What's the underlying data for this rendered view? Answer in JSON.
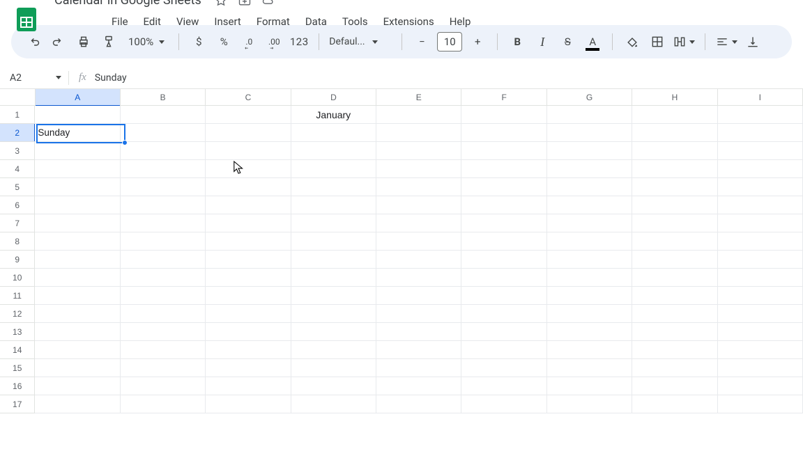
{
  "doc": {
    "title": "Calendar in Google Sheets"
  },
  "menus": [
    "File",
    "Edit",
    "View",
    "Insert",
    "Format",
    "Data",
    "Tools",
    "Extensions",
    "Help"
  ],
  "toolbar": {
    "zoom": "100%",
    "currency": "$",
    "percent": "%",
    "dec_dec": ".0",
    "inc_dec": ".00",
    "numfmt": "123",
    "font_name": "Defaul...",
    "font_size": "10",
    "bold": "B",
    "italic": "I",
    "strike": "S",
    "text_color": "A",
    "minus": "−",
    "plus": "+"
  },
  "formula_bar": {
    "namebox": "A2",
    "fx": "fx",
    "content": "Sunday"
  },
  "grid": {
    "columns": [
      "A",
      "B",
      "C",
      "D",
      "E",
      "F",
      "G",
      "H",
      "I"
    ],
    "row_count": 17,
    "selected_col_index": 0,
    "selected_row_index": 1,
    "cells": {
      "r1": {
        "D": "January"
      },
      "r2": {
        "A": "Sunday"
      }
    }
  },
  "chart_data": {
    "type": "table",
    "columns": [
      "A",
      "B",
      "C",
      "D",
      "E",
      "F",
      "G",
      "H",
      "I"
    ],
    "rows": [
      {
        "row": 1,
        "A": "",
        "B": "",
        "C": "",
        "D": "January",
        "E": "",
        "F": "",
        "G": "",
        "H": "",
        "I": ""
      },
      {
        "row": 2,
        "A": "Sunday",
        "B": "",
        "C": "",
        "D": "",
        "E": "",
        "F": "",
        "G": "",
        "H": "",
        "I": ""
      }
    ],
    "note": "rows 3-17 are empty"
  }
}
